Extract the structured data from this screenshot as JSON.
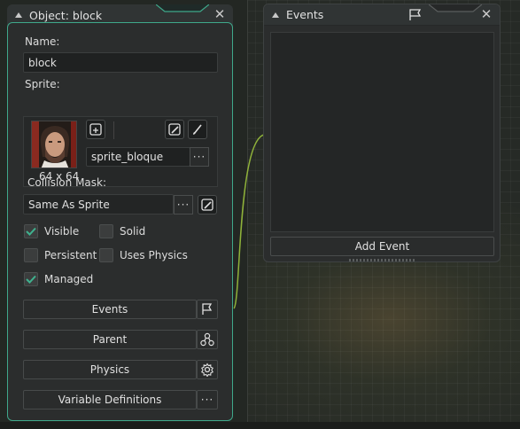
{
  "object_window": {
    "title": "Object: block",
    "name_label": "Name:",
    "name_value": "block",
    "sprite_label": "Sprite:",
    "sprite_name": "sprite_bloque",
    "sprite_size": "64 x 64",
    "collision_label": "Collision Mask:",
    "collision_value": "Same As Sprite",
    "dots": "···",
    "checkboxes": [
      {
        "label": "Visible",
        "checked": true
      },
      {
        "label": "Solid",
        "checked": false
      },
      {
        "label": "Persistent",
        "checked": false
      },
      {
        "label": "Uses Physics",
        "checked": false
      },
      {
        "label": "Managed",
        "checked": true
      }
    ],
    "buttons": {
      "events": "Events",
      "parent": "Parent",
      "physics": "Physics",
      "variable_definitions": "Variable Definitions"
    }
  },
  "events_window": {
    "title": "Events",
    "add_event": "Add Event"
  },
  "colors": {
    "accent": "#3fa88a",
    "check": "#3fb28f",
    "connector": "#8fb23a"
  },
  "icons": [
    "close-icon",
    "collapse-icon",
    "new-sprite-icon",
    "edit-image-icon",
    "brush-icon",
    "flag-icon",
    "parent-icon",
    "physics-gear-icon",
    "dots-icon"
  ]
}
